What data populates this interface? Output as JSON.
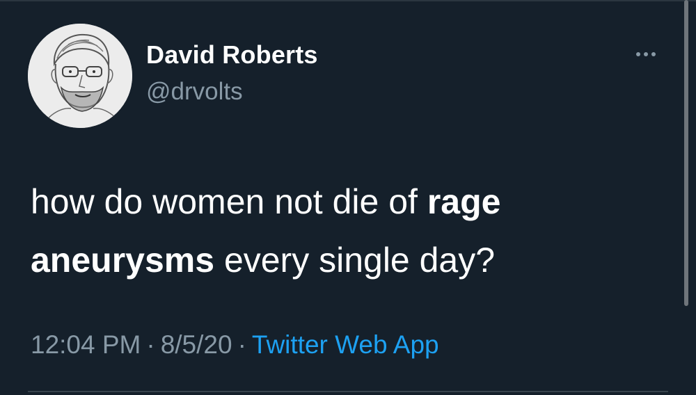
{
  "tweet": {
    "author": {
      "display_name": "David Roberts",
      "handle": "@drvolts",
      "avatar_icon": "sketch-portrait-avatar"
    },
    "text": {
      "part1": "how do women not die of ",
      "bold1": "rage",
      "bold2": "aneurysms",
      "part2": " every single day?"
    },
    "time": "12:04 PM",
    "date": "8/5/20",
    "separator": "·",
    "source": "Twitter Web App"
  },
  "colors": {
    "background": "#15202b",
    "primary_text": "#ffffff",
    "secondary_text": "#8899a6",
    "link": "#1da1f2"
  },
  "icons": {
    "more": "more-horizontal-icon"
  }
}
